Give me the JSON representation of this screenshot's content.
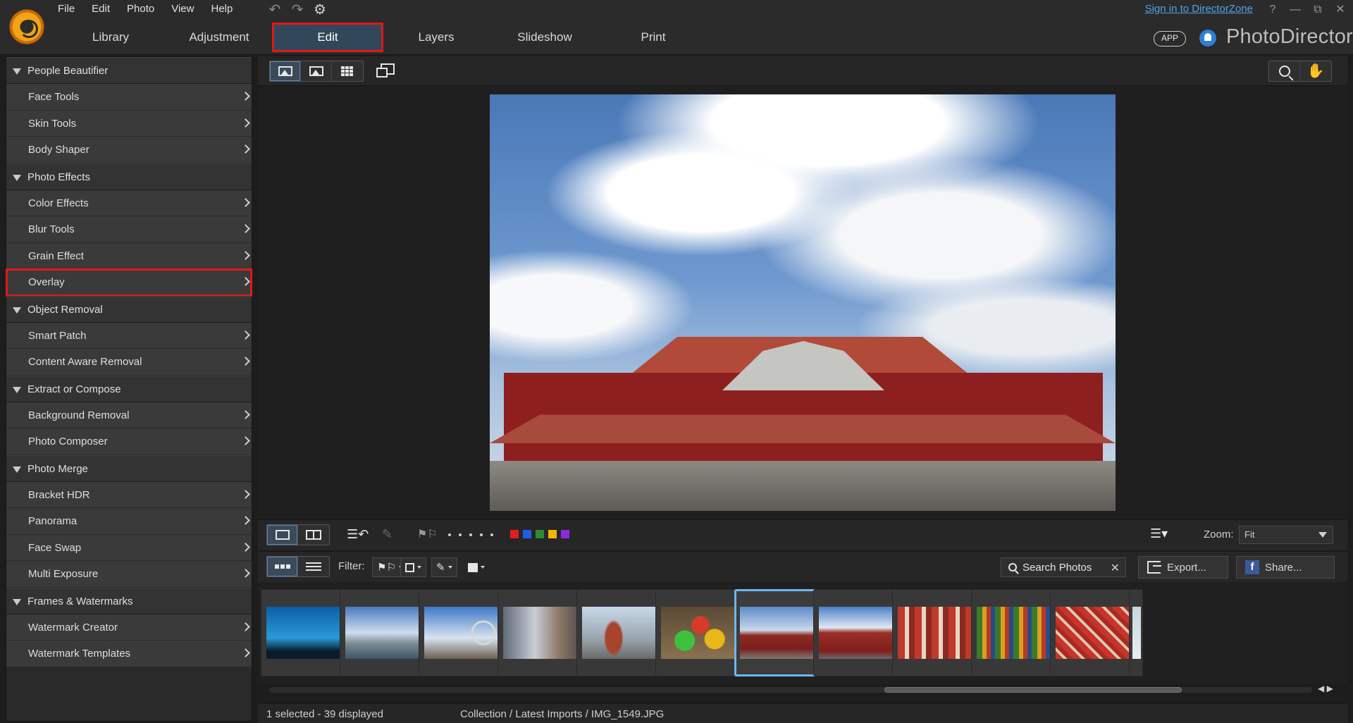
{
  "menu": [
    "File",
    "Edit",
    "Photo",
    "View",
    "Help"
  ],
  "mode_tabs": [
    {
      "label": "Library"
    },
    {
      "label": "Adjustment"
    },
    {
      "label": "Edit"
    },
    {
      "label": "Layers"
    },
    {
      "label": "Slideshow"
    },
    {
      "label": "Print"
    }
  ],
  "active_tab": "Edit",
  "sign_in": "Sign in to DirectorZone",
  "window_controls": {
    "help": "?",
    "minimize": "—",
    "restore": "⧉",
    "close": "✕"
  },
  "app_badge": "APP",
  "brand": "PhotoDirector",
  "left_panel": {
    "sections": [
      {
        "title": "People Beautifier",
        "items": [
          "Face Tools",
          "Skin Tools",
          "Body Shaper"
        ]
      },
      {
        "title": "Photo Effects",
        "items": [
          "Color Effects",
          "Blur Tools",
          "Grain Effect",
          "Overlay"
        ]
      },
      {
        "title": "Object Removal",
        "items": [
          "Smart Patch",
          "Content Aware Removal"
        ]
      },
      {
        "title": "Extract or Compose",
        "items": [
          "Background Removal",
          "Photo Composer"
        ]
      },
      {
        "title": "Photo Merge",
        "items": [
          "Bracket HDR",
          "Panorama",
          "Face Swap",
          "Multi Exposure"
        ]
      },
      {
        "title": "Frames & Watermarks",
        "items": [
          "Watermark Creator",
          "Watermark Templates"
        ]
      }
    ],
    "highlighted_item": "Overlay"
  },
  "color_labels": [
    "#e21c1c",
    "#1f5ee6",
    "#2e8a2e",
    "#f2b705",
    "#8a2be2"
  ],
  "zoom": {
    "label": "Zoom:",
    "value": "Fit"
  },
  "filter": {
    "label": "Filter:"
  },
  "search": {
    "placeholder": "Search Photos"
  },
  "export_label": "Export...",
  "share_label": "Share...",
  "thumbnails": [
    {
      "name": "aquarium"
    },
    {
      "name": "harbor"
    },
    {
      "name": "ferris-wheel"
    },
    {
      "name": "city-street"
    },
    {
      "name": "shisa-statue"
    },
    {
      "name": "colorful-sweets"
    },
    {
      "name": "shuri-castle",
      "selected": true
    },
    {
      "name": "shuri-castle-2"
    },
    {
      "name": "souvenir-shop"
    },
    {
      "name": "market-stall"
    },
    {
      "name": "market-goods"
    }
  ],
  "status": {
    "selection": "1 selected - 39 displayed",
    "path": "Collection / Latest Imports / IMG_1549.JPG"
  }
}
